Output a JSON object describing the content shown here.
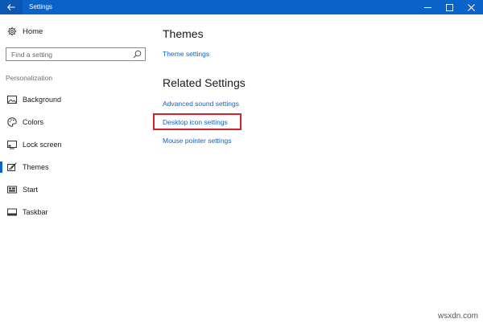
{
  "window": {
    "title": "Settings",
    "back_icon": "back-arrow-icon",
    "controls": {
      "minimize_icon": "minimize-icon",
      "maximize_icon": "maximize-icon",
      "close_icon": "close-icon"
    },
    "accent_color": "#0a63c9"
  },
  "sidebar": {
    "home": {
      "label": "Home",
      "icon": "gear-icon"
    },
    "search": {
      "placeholder": "Find a setting",
      "value": ""
    },
    "section_label": "Personalization",
    "items": [
      {
        "label": "Background",
        "icon": "picture-icon",
        "active": false
      },
      {
        "label": "Colors",
        "icon": "palette-icon",
        "active": false
      },
      {
        "label": "Lock screen",
        "icon": "lock-screen-icon",
        "active": false
      },
      {
        "label": "Themes",
        "icon": "themes-brush-icon",
        "active": true
      },
      {
        "label": "Start",
        "icon": "start-icon",
        "active": false
      },
      {
        "label": "Taskbar",
        "icon": "taskbar-icon",
        "active": false
      }
    ]
  },
  "main": {
    "themes_heading": "Themes",
    "theme_settings_link": "Theme settings",
    "related_heading": "Related Settings",
    "related_links": [
      "Advanced sound settings",
      "Desktop icon settings",
      "Mouse pointer settings"
    ],
    "highlight_color": "#d0232a"
  },
  "watermark": "wsxdn.com"
}
